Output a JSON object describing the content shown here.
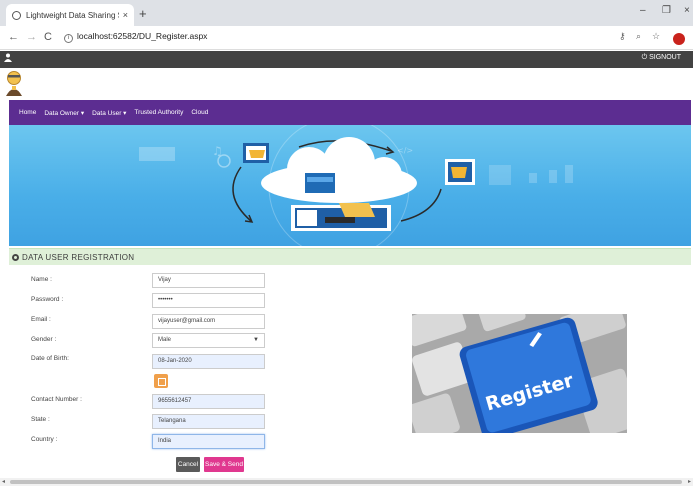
{
  "browser": {
    "tab_title": "Lightweight Data Sharing Scheme",
    "tab_close": "×",
    "new_tab": "+",
    "url_host": "localhost",
    "url_path": ":62582/DU_Register.aspx",
    "back": "←",
    "forward": "→",
    "reload": "C",
    "minimize": "–",
    "restore": "❐",
    "close": "×"
  },
  "topbar": {
    "user_icon": "user-icon",
    "signout_label": "SIGNOUT"
  },
  "nav": {
    "items": [
      "Home",
      "Data Owner ▾",
      "Data User ▾",
      "Trusted Authority",
      "Cloud"
    ]
  },
  "section": {
    "title": "DATA USER REGISTRATION"
  },
  "form": {
    "name_label": "Name :",
    "name_value": "Vijay",
    "password_label": "Password :",
    "password_value": "•••••••",
    "email_label": "Email :",
    "email_value": "vijayuser@gmail.com",
    "gender_label": "Gender :",
    "gender_value": "Male",
    "dob_label": "Date of Birth:",
    "dob_value": "08-Jan-2020",
    "contact_label": "Contact Number :",
    "contact_value": "9655612457",
    "state_label": "State :",
    "state_value": "Telangana",
    "country_label": "Country :",
    "country_value": "India",
    "cancel_label": "Cancel",
    "save_label": "Save & Send"
  },
  "register_image": {
    "key_text": "Register"
  },
  "colors": {
    "nav_bg": "#5c2d91",
    "section_bg": "#dff0d8",
    "save_btn": "#e0388f",
    "cancel_btn": "#5a5a5a",
    "topstrip": "#424242"
  }
}
